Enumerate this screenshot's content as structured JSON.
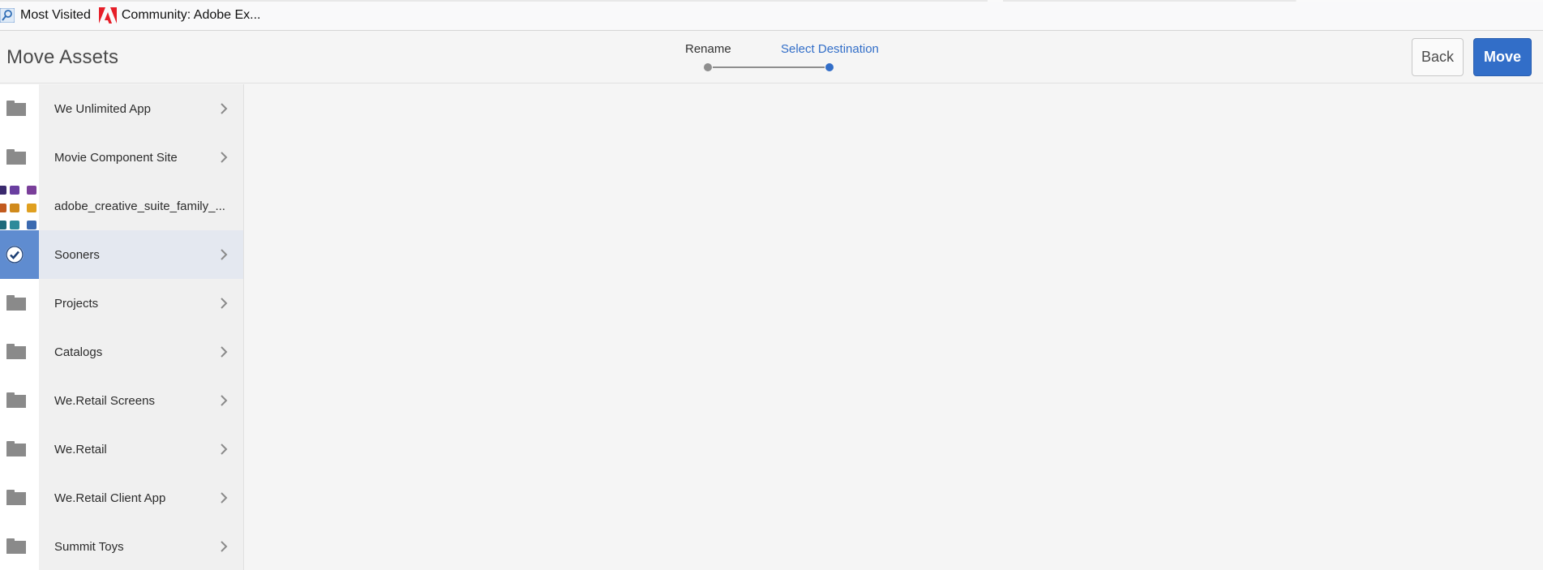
{
  "bookmarks": {
    "items": [
      {
        "label": "Most Visited",
        "icon": "most-visited-icon"
      },
      {
        "label": "Community: Adobe Ex...",
        "icon": "adobe-logo-icon"
      }
    ]
  },
  "header": {
    "title": "Move Assets",
    "steps": [
      {
        "label": "Rename",
        "state": "done"
      },
      {
        "label": "Select Destination",
        "state": "current"
      }
    ],
    "back_label": "Back",
    "move_label": "Move"
  },
  "colors": {
    "accent": "#326ec8",
    "selected_thumb": "#5f8cd0",
    "selected_row": "#e4e8f0",
    "folder": "#8a8a8a"
  },
  "destinations": [
    {
      "label": "We Unlimited App",
      "icon": "folder-icon",
      "has_children": true,
      "selected": false
    },
    {
      "label": "Movie Component Site",
      "icon": "folder-icon",
      "has_children": true,
      "selected": false
    },
    {
      "label": "adobe_creative_suite_family_...",
      "icon": "image-thumbnail",
      "has_children": false,
      "selected": false
    },
    {
      "label": "Sooners",
      "icon": "checkmark-icon",
      "has_children": true,
      "selected": true
    },
    {
      "label": "Projects",
      "icon": "folder-icon",
      "has_children": true,
      "selected": false
    },
    {
      "label": "Catalogs",
      "icon": "folder-icon",
      "has_children": true,
      "selected": false
    },
    {
      "label": "We.Retail Screens",
      "icon": "folder-icon",
      "has_children": true,
      "selected": false
    },
    {
      "label": "We.Retail",
      "icon": "folder-icon",
      "has_children": true,
      "selected": false
    },
    {
      "label": "We.Retail Client App",
      "icon": "folder-icon",
      "has_children": true,
      "selected": false
    },
    {
      "label": "Summit Toys",
      "icon": "folder-icon",
      "has_children": true,
      "selected": false
    }
  ]
}
